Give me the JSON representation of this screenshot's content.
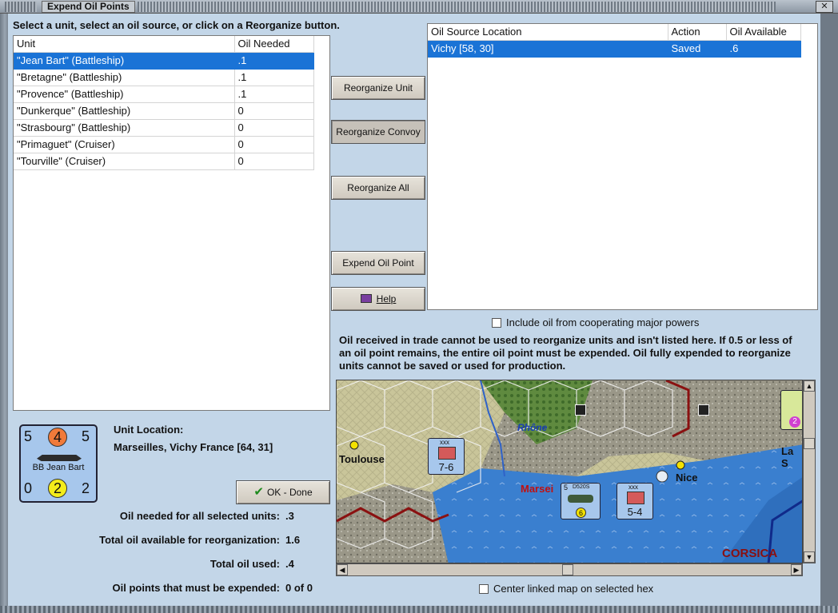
{
  "window": {
    "title": "Expend Oil Points"
  },
  "instruction": "Select a unit, select an oil source, or click on a Reorganize button.",
  "units_table": {
    "columns": [
      "Unit",
      "Oil Needed"
    ],
    "rows": [
      {
        "unit": "\"Jean Bart\" (Battleship)",
        "oil": ".1"
      },
      {
        "unit": "\"Bretagne\" (Battleship)",
        "oil": ".1"
      },
      {
        "unit": "\"Provence\" (Battleship)",
        "oil": ".1"
      },
      {
        "unit": "\"Dunkerque\" (Battleship)",
        "oil": "0"
      },
      {
        "unit": "\"Strasbourg\" (Battleship)",
        "oil": "0"
      },
      {
        "unit": "\"Primaguet\" (Cruiser)",
        "oil": "0"
      },
      {
        "unit": "\"Tourville\" (Cruiser)",
        "oil": "0"
      }
    ],
    "selected_row": 0
  },
  "oil_table": {
    "columns": [
      "Oil Source Location",
      "Action",
      "Oil Available"
    ],
    "rows": [
      {
        "location": "Vichy [58, 30]",
        "action": "Saved",
        "available": ".6"
      }
    ],
    "selected_row": 0
  },
  "buttons": {
    "reorganize_unit": "Reorganize Unit",
    "reorganize_convoy": "Reorganize Convoy",
    "reorganize_all": "Reorganize All",
    "expend_oil_point": "Expend Oil Point",
    "help": "Help",
    "ok_done": "OK - Done"
  },
  "checkboxes": {
    "cooperating": "Include oil from cooperating major powers",
    "center_map": "Center linked map on selected hex"
  },
  "note": "Oil received in trade cannot be used to reorganize units and isn't listed here.  If 0.5 or less of an oil point remains, the entire oil point must be expended.   Oil fully expended to reorganize units cannot be saved or used for production.",
  "unit_counter": {
    "top_left": "5",
    "top_mid": "4",
    "top_right": "5",
    "name": "BB Jean Bart",
    "bottom_left": "0",
    "bottom_mid": "2",
    "bottom_right": "2"
  },
  "unit_location": {
    "label": "Unit Location:",
    "value": "Marseilles, Vichy France [64, 31]"
  },
  "stats": {
    "oil_needed_label": "Oil needed for all selected units:",
    "oil_needed": ".3",
    "total_available_label": "Total oil available for reorganization:",
    "total_available": "1.6",
    "total_used_label": "Total oil used:",
    "total_used": ".4",
    "must_expend_label": "Oil points that must be expended:",
    "must_expend": "0 of 0"
  },
  "map": {
    "labels": {
      "toulouse": "Toulouse",
      "rhone": "Rhône",
      "marseilles": "Marsei",
      "nice": "Nice",
      "la_s": "La S",
      "corsica": "CORSICA"
    },
    "unit_a": {
      "top": "xxx",
      "value": "7-6"
    },
    "unit_b": {
      "top": "5",
      "type": "D520S",
      "value": "6"
    },
    "unit_c": {
      "top": "xxx",
      "value": "5-4"
    },
    "unit_d": {
      "value": "2"
    }
  },
  "colors": {
    "selection": "#1a73d6",
    "client_bg": "#c3d6e8",
    "counter_bg": "#a7c7ec"
  }
}
